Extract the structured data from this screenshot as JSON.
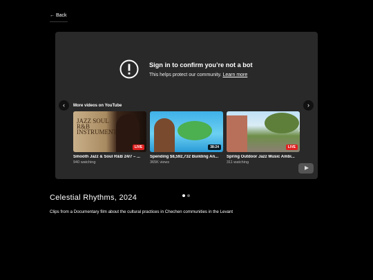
{
  "nav": {
    "back_label": "← Back"
  },
  "player": {
    "signin_title": "Sign in to confirm you’re not a bot",
    "signin_subtitle": "This helps protect our community.",
    "learn_more": "Learn more",
    "more_videos_title": "More videos on YouTube",
    "prev_icon": "‹",
    "next_icon": "›",
    "videos": [
      {
        "title": "Smooth Jazz & Soul R&B 24/7 – ...",
        "meta": "940 watching",
        "badge": "LIVE",
        "thumb_text": "JAZZ SOUL R&B INSTRUMENTALS"
      },
      {
        "title": "Spending $8,592,732 Building An...",
        "meta": "365K views",
        "badge": "38:24"
      },
      {
        "title": "Spring Outdoor Jazz Music Ambi...",
        "meta": "311 watching",
        "badge": "LIVE"
      }
    ]
  },
  "content": {
    "title": "Celestial Rhythms, 2024",
    "description": "Clips from a Documentary film about the cultural practices in Chechen communities in the Levant"
  }
}
